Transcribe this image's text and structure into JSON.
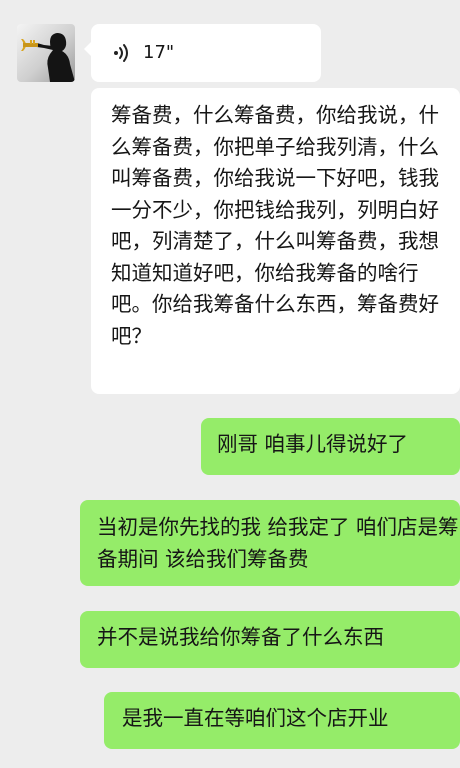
{
  "incoming": {
    "avatar_icon": "trumpet-player-silhouette",
    "voice": {
      "icon": "voice-wave-icon",
      "duration": "17\""
    },
    "text": "筹备费，什么筹备费，你给我说，什么筹备费，你把单子给我列清，什么叫筹备费，你给我说一下好吧，钱我一分不少，你把钱给我列，列明白好吧，列清楚了，什么叫筹备费，我想知道知道好吧，你给我筹备的啥行吧。你给我筹备什么东西，筹备费好吧？"
  },
  "outgoing": [
    "刚哥 咱事儿得说好了",
    "当初是你先找的我 给我定了 咱们店是筹备期间 该给我们筹备费",
    "并不是说我给你筹备了什么东西",
    "是我一直在等咱们这个店开业"
  ],
  "colors": {
    "background": "#ededed",
    "incoming_bubble": "#ffffff",
    "outgoing_bubble": "#95ec69"
  }
}
